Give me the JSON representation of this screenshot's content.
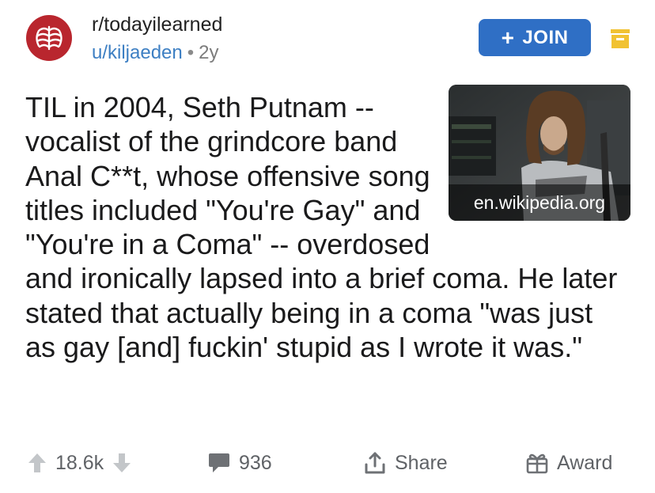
{
  "post": {
    "subreddit": "r/todayilearned",
    "author": "u/kiljaeden",
    "separator": "•",
    "age": "2y",
    "title": "TIL in 2004, Seth Putnam -- vocalist of the grindcore band Anal C**t, whose offensive song titles included \"You're Gay\" and \"You're in a Coma\" -- overdosed and ironically lapsed into a brief coma. He later stated that actually being in a coma \"was just as gay [and] fuckin' stupid as I wrote it was.\"",
    "thumbnail_domain": "en.wikipedia.org"
  },
  "header": {
    "join_label": "JOIN",
    "join_icon": "plus-icon"
  },
  "actions": {
    "votes": "18.6k",
    "comments": "936",
    "share_label": "Share",
    "award_label": "Award"
  },
  "colors": {
    "brand_red": "#b9262e",
    "join_blue": "#2f6fc5",
    "save_yellow": "#f1c232",
    "link_blue": "#3d7fc3"
  }
}
